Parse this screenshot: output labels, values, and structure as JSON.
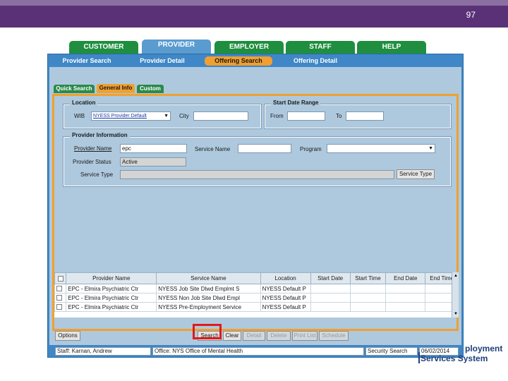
{
  "slide": {
    "number": "97"
  },
  "main_tabs": [
    "CUSTOMER",
    "PROVIDER",
    "EMPLOYER",
    "STAFF",
    "HELP"
  ],
  "sub_tabs": [
    "Provider Search",
    "Provider Detail",
    "Offering Search",
    "Offering Detail"
  ],
  "inner_tabs": [
    "Quick Search",
    "General Info",
    "Custom"
  ],
  "location": {
    "title": "Location",
    "wib_label": "WIB",
    "wib_value": "NYESS Provider Default",
    "city_label": "City",
    "city_value": ""
  },
  "start_date_range": {
    "title": "Start Date Range",
    "from_label": "From",
    "to_label": "To"
  },
  "provider_info": {
    "title": "Provider Information",
    "provider_name_label": "Provider Name",
    "provider_name_value": "epc",
    "service_name_label": "Service Name",
    "program_label": "Program",
    "provider_status_label": "Provider Status",
    "provider_status_value": "Active",
    "service_type_label": "Service Type",
    "service_type_button": "Service Type"
  },
  "table": {
    "headers": [
      "Provider Name",
      "Service Name",
      "Location",
      "Start Date",
      "Start Time",
      "End Date",
      "End Time"
    ],
    "rows": [
      [
        "EPC - Elmira Psychiatric Ctr",
        "NYESS Job Site Dlwd Emplmt S",
        "NYESS Default P",
        "",
        "",
        "",
        ""
      ],
      [
        "EPC - Elmira Psychiatric Ctr",
        "NYESS Non Job Site Dlwd Empl",
        "NYESS Default P",
        "",
        "",
        "",
        ""
      ],
      [
        "EPC - Elmira Psychiatric Ctr",
        "NYESS Pre-Employment Service",
        "NYESS Default P",
        "",
        "",
        "",
        ""
      ]
    ]
  },
  "buttons": {
    "options": "Options",
    "search": "Search",
    "clear": "Clear",
    "detail": "Detail",
    "delete": "Delete",
    "print_list": "Print List",
    "schedule": "Schedule"
  },
  "status_bar": {
    "staff": "Staff: Karnan, Andrew",
    "office": "Office: NYS Office of Mental Health",
    "screen": "Security Search",
    "date": "06/02/2014"
  },
  "logo": {
    "line1": "ployment",
    "line2": "Services System"
  },
  "colors": {
    "header_purple": "#5a3177",
    "tab_green": "#1f8f3f",
    "app_blue": "#3f87c6",
    "accent_orange": "#f0a030",
    "highlight_red": "#e01b1b"
  }
}
